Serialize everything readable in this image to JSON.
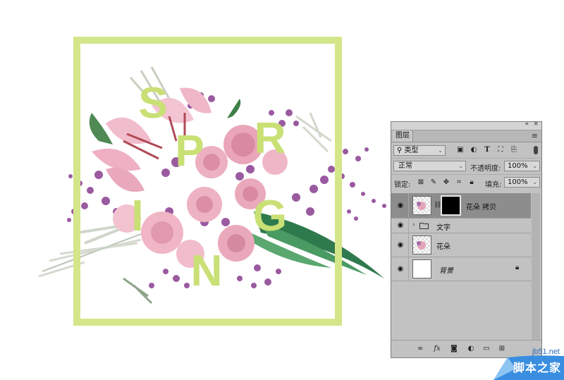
{
  "artwork": {
    "letters": [
      "S",
      "P",
      "R",
      "I",
      "N",
      "G"
    ],
    "frame_color": "#d4e68a",
    "letter_color": "#c9e075"
  },
  "panel": {
    "collapse_icon": "double-chevron-left-icon",
    "close_icon": "close-icon",
    "tab_label": "图层",
    "menu_icon": "hamburger-icon",
    "filter": {
      "search_icon": "search-icon",
      "type_label": "类型",
      "icons": [
        "image-filter-icon",
        "adjustment-filter-icon",
        "type-filter-icon",
        "shape-filter-icon",
        "smart-object-filter-icon"
      ]
    },
    "blend_mode": "正常",
    "opacity_label": "不透明度:",
    "opacity_value": "100%",
    "lock_label": "锁定:",
    "lock_icons": [
      "lock-transparency-icon",
      "lock-pixels-icon",
      "lock-position-icon",
      "lock-artboard-icon",
      "lock-all-icon"
    ],
    "fill_label": "填充:",
    "fill_value": "100%",
    "layers": [
      {
        "name": "花朵 拷贝",
        "selected": true,
        "type": "pixel-with-mask",
        "visible": true
      },
      {
        "name": "文字",
        "selected": false,
        "type": "group",
        "visible": true
      },
      {
        "name": "花朵",
        "selected": false,
        "type": "pixel",
        "visible": true
      },
      {
        "name": "背景",
        "selected": false,
        "type": "background",
        "visible": true,
        "locked": true
      }
    ],
    "bottom_icons": [
      "link-layers-icon",
      "fx-icon",
      "add-mask-icon",
      "adjustment-layer-icon",
      "new-group-icon",
      "new-layer-icon",
      "delete-icon"
    ],
    "fx_label": "fx"
  },
  "watermark": {
    "domain": "jb51.net",
    "name": "脚本之家"
  }
}
